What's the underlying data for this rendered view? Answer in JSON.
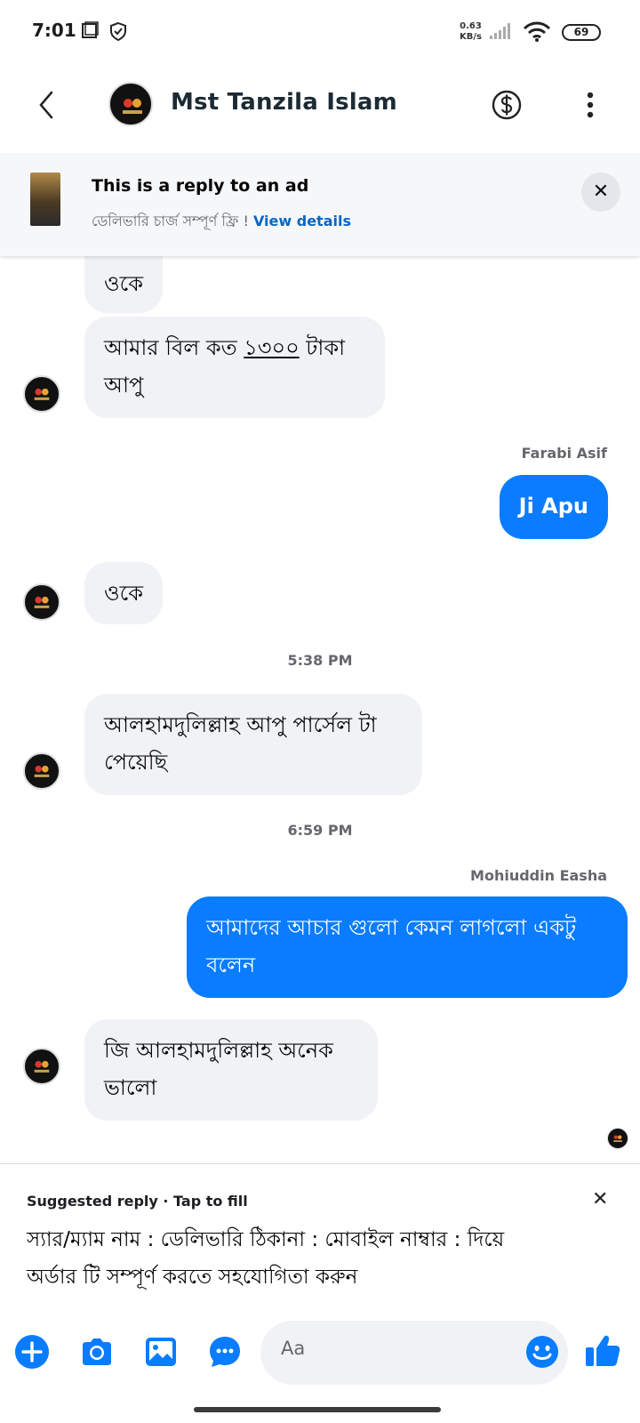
{
  "status_bar": {
    "time": "7:01",
    "net_speed_value": "0.63",
    "net_speed_unit": "KB/s",
    "battery": "69"
  },
  "header": {
    "contact_name": "Mst Tanzila Islam"
  },
  "ad_banner": {
    "title": "This is a reply to an ad",
    "subtitle": "ডেলিভারি চার্জ সম্পূর্ণ ফ্রি ! ",
    "link": "View details"
  },
  "messages": [
    {
      "text": "ওকে"
    },
    {
      "text_pre": "আমার বিল কত ",
      "text_num": "১৩০০",
      "text_post": " টাকা",
      "text_line2": "আপু"
    },
    {
      "sender": "Farabi Asif",
      "text": "Ji Apu"
    },
    {
      "text": "ওকে"
    },
    {
      "timestamp": "5:38 PM"
    },
    {
      "text_line1": "আলহামদুলিল্লাহ আপু পার্সেল টা",
      "text_line2": "পেয়েছি"
    },
    {
      "timestamp": "6:59 PM"
    },
    {
      "sender": "Mohiuddin Easha",
      "text_line1": "আমাদের আচার গুলো কেমন লাগলো একটু",
      "text_line2": "বলেন"
    },
    {
      "text_line1": "জি আলহামদুলিল্লাহ অনেক",
      "text_line2": "ভালো"
    }
  ],
  "suggested_reply": {
    "label": "Suggested reply",
    "separator": " · ",
    "hint": "Tap to fill",
    "close": "✕",
    "line1": "স্যার/ম্যাম নাম : ডেলিভারি ঠিকানা : মোবাইল নাম্বার : দিয়ে",
    "line2": "অর্ডার টি সম্পূর্ণ করতে সহযোগিতা করুন"
  },
  "composer": {
    "placeholder": "Aa"
  },
  "colors": {
    "accent": "#0a7cff",
    "incoming_bubble": "#f0f2f5",
    "link": "#0a66c2"
  },
  "icons": [
    "back-icon",
    "dollar-icon",
    "more-icon",
    "close-icon",
    "plus-icon",
    "camera-icon",
    "gallery-icon",
    "chat-more-icon",
    "emoji-icon",
    "like-icon",
    "wifi-icon",
    "signal-icon",
    "battery-icon"
  ]
}
